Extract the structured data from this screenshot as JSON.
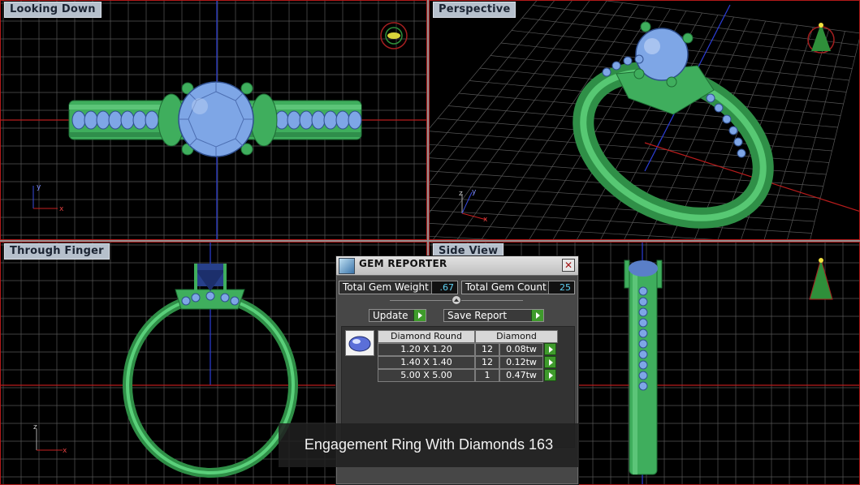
{
  "viewports": {
    "looking_down": {
      "label": "Looking Down"
    },
    "perspective": {
      "label": "Perspective"
    },
    "through_finger": {
      "label": "Through Finger"
    },
    "side_view": {
      "label": "Side View"
    }
  },
  "gem_reporter": {
    "title": "GEM REPORTER",
    "close_glyph": "✕",
    "total_weight_label": "Total Gem Weight",
    "total_weight_value": ".67",
    "total_count_label": "Total Gem Count",
    "total_count_value": "25",
    "update_label": "Update",
    "save_report_label": "Save Report",
    "table": {
      "headers": [
        "Diamond Round",
        "Diamond"
      ],
      "rows": [
        {
          "size": "1.20 X 1.20",
          "count": "12",
          "weight": "0.08tw"
        },
        {
          "size": "1.40 X 1.40",
          "count": "12",
          "weight": "0.12tw"
        },
        {
          "size": "5.00 X 5.00",
          "count": "1",
          "weight": "0.47tw"
        }
      ]
    }
  },
  "caption": "Engagement Ring With Diamonds 163",
  "colors": {
    "metal": "#3fae5d",
    "gem": "#7ea6e6",
    "grid": "#565656",
    "viewport_border": "#b21a1a",
    "accent_green": "#3f9b2c"
  }
}
